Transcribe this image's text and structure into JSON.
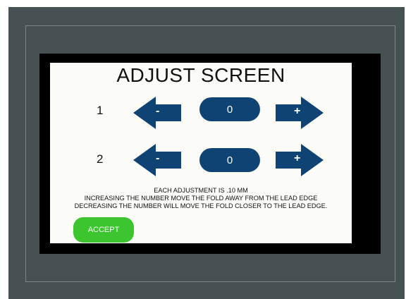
{
  "screen": {
    "title": "ADJUST SCREEN",
    "rows": [
      {
        "label": "1",
        "decrease_symbol": "-",
        "value": "0",
        "increase_symbol": "+"
      },
      {
        "label": "2",
        "decrease_symbol": "-",
        "value": "0",
        "increase_symbol": "+"
      }
    ],
    "info_lines": [
      "EACH ADJUSTMENT IS .10 MM",
      "INCREASING THE NUMBER MOVE THE FOLD AWAY FROM THE LEAD EDGE",
      "DECREASING THE NUMBER WILL MOVE THE FOLD CLOSER TO THE LEAD EDGE."
    ],
    "accept_label": "ACCEPT"
  },
  "colors": {
    "bezel": "#465153",
    "arrow_blue": "#0e4374",
    "accept_green": "#3cc52f"
  },
  "icons": {
    "decrease": "left-arrow-icon",
    "increase": "right-arrow-icon"
  }
}
